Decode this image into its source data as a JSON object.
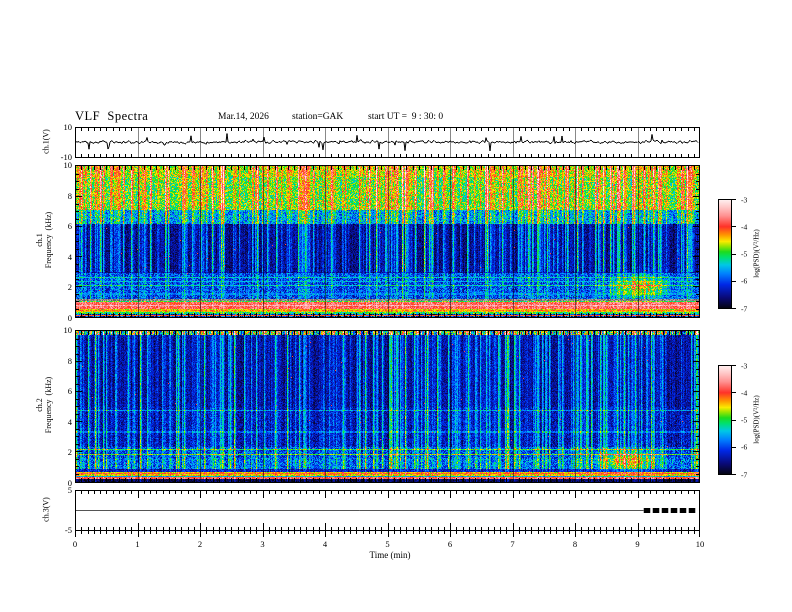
{
  "header": {
    "title": "VLF  Spectra",
    "date": "Mar.14, 2026",
    "station": "station=GAK",
    "start_ut": "start UT =  9 : 30: 0"
  },
  "axes": {
    "time": {
      "label": "Time  (min)",
      "ticks": [
        "0",
        "1",
        "2",
        "3",
        "4",
        "5",
        "6",
        "7",
        "8",
        "9",
        "10"
      ],
      "range": [
        0,
        10
      ]
    },
    "wave1": {
      "label": "ch.1(V)",
      "ticks": [
        "10",
        "-10"
      ],
      "range": [
        -10,
        10
      ]
    },
    "spec1": {
      "label_line1": "ch.1",
      "label_line2": "Frequency  (kHz)",
      "ticks": [
        "10",
        "8",
        "6",
        "4",
        "2",
        "0"
      ],
      "range": [
        0,
        10
      ]
    },
    "spec2": {
      "label_line1": "ch.2",
      "label_line2": "Frequency  (kHz)",
      "ticks": [
        "10",
        "8",
        "6",
        "4",
        "2",
        "0"
      ],
      "range": [
        0,
        10
      ]
    },
    "wave3": {
      "label": "ch.3(V)",
      "ticks": [
        "5",
        "-5"
      ],
      "range": [
        -5,
        5
      ]
    },
    "colorbar": {
      "label": "log(PSD)(V²/Hz)",
      "ticks": [
        "-3",
        "-4",
        "-5",
        "-6",
        "-7"
      ],
      "range": [
        -7,
        -3
      ]
    }
  },
  "colors": {
    "frame": "#000000",
    "waveform": "#000000",
    "ch3_line": "#555555",
    "minute_line_wave": "#888888",
    "colormap_stops": [
      [
        0.0,
        5,
        5,
        15
      ],
      [
        0.1,
        10,
        10,
        120
      ],
      [
        0.22,
        0,
        40,
        230
      ],
      [
        0.32,
        0,
        130,
        255
      ],
      [
        0.4,
        0,
        200,
        230
      ],
      [
        0.47,
        0,
        225,
        110
      ],
      [
        0.52,
        30,
        220,
        30
      ],
      [
        0.575,
        160,
        230,
        0
      ],
      [
        0.615,
        250,
        235,
        0
      ],
      [
        0.675,
        255,
        150,
        0
      ],
      [
        0.75,
        255,
        50,
        40
      ],
      [
        0.85,
        255,
        145,
        145
      ],
      [
        0.93,
        255,
        200,
        200
      ],
      [
        1.0,
        255,
        242,
        242
      ]
    ]
  },
  "chart_data": [
    {
      "type": "line",
      "name": "ch1_waveform",
      "title": "ch.1 (V) time series",
      "xlim": [
        0,
        10
      ],
      "ylim": [
        -10,
        10
      ],
      "summary": "Noisy trace centred on 0 V, typical excursions about ±2 V, frequent impulsive spikes reaching ±4 to ±8 V over the whole 10 min record",
      "render": {
        "seed": 11,
        "sigma": 1.0,
        "smooth": 0.45,
        "spike_prob": 0.05,
        "spike_min": 2,
        "spike_max": 6.5
      }
    },
    {
      "type": "heatmap",
      "name": "ch1_spectrogram",
      "title": "ch.1 VLF spectrogram",
      "xlabel": "Time (min)",
      "ylabel": "Frequency (kHz)",
      "xlim": [
        0,
        10
      ],
      "ylim": [
        0,
        10
      ],
      "zlim": [
        -7,
        -3
      ],
      "zlabel": "log(PSD)(V²/Hz)",
      "features": [
        "broadband green/cyan emission above ~7 kHz near -5",
        "dark navy background (~-6.5) from 3 to 6 kHz",
        "dense vertical impulsive streaks (sferics) spanning full height",
        "intense orange/red band 0.5-0.95 kHz near -3.8 with red core at ~0.75 kHz",
        "saturated gray row near 1 kHz",
        "narrow cyan lines near 2.1, 2.35 and 2.6 kHz",
        "green enhancement near 1.9 kHz between 8.7 and 9.4 min"
      ],
      "render": {
        "seed": 21,
        "bands": [
          [
            9.3,
            10,
            -4.75,
            0.45
          ],
          [
            7.1,
            9.3,
            -4.95,
            0.5
          ],
          [
            6.2,
            7.1,
            -5.7,
            0.55
          ],
          [
            2.9,
            6.2,
            -6.55,
            0.3
          ],
          [
            1.15,
            2.9,
            -6.05,
            0.5
          ],
          [
            1.02,
            1.15,
            -6,
            0
          ],
          [
            0.95,
            1.02,
            -5.0,
            0.4
          ],
          [
            0.52,
            0.95,
            -3.85,
            0.3
          ],
          [
            0.33,
            0.52,
            -4.55,
            0.35
          ],
          [
            0.18,
            0.33,
            -5.1,
            0.45
          ],
          [
            0.0,
            0.18,
            -6.3,
            0.9
          ]
        ],
        "gray_band": [
          1.02,
          1.15
        ],
        "hlines": [
          [
            2.08,
            -5.35
          ],
          [
            2.32,
            -5.6
          ],
          [
            2.6,
            -5.45
          ],
          [
            1.5,
            -5.8
          ],
          [
            0.74,
            -3.5
          ],
          [
            0.42,
            -4.3
          ],
          [
            0.05,
            -4.1
          ]
        ],
        "streaks": {
          "density": 0.5,
          "strength": 1.7,
          "atten": [
            [
              1,
              0.15
            ],
            [
              3,
              0.45
            ]
          ]
        },
        "blob": {
          "t": 9.05,
          "f": 1.95,
          "dt": 0.3,
          "df": 0.5,
          "boost": 1.4
        },
        "red_dot_prob": 0.0008
      }
    },
    {
      "type": "heatmap",
      "name": "ch2_spectrogram",
      "title": "ch.2 VLF spectrogram",
      "xlabel": "Time (min)",
      "ylabel": "Frequency (kHz)",
      "xlim": [
        0,
        10
      ],
      "ylim": [
        0,
        10
      ],
      "zlim": [
        -7,
        -3
      ],
      "zlabel": "log(PSD)(V²/Hz)",
      "features": [
        "mostly dark navy background (~-6.5) with dense thin vertical sferic streaks",
        "colorful columnar band in the top rows near 10 kHz",
        "narrow cyan/green lines near 1.78 and 2.12 kHz, fainter ones near 3.3 and 4.7 kHz",
        "bright green/yellow band 0.4-0.65 kHz near -4.5",
        "thin red band near 0.2 kHz, nearly black lowest rows",
        "green enhancement near 1.4 kHz between 8.5 and 9.2 min"
      ],
      "render": {
        "seed": 37,
        "bands": [
          [
            9.8,
            10,
            -5.2,
            0.8
          ],
          [
            5.0,
            9.8,
            -6.5,
            0.3
          ],
          [
            2.3,
            5.0,
            -6.4,
            0.35
          ],
          [
            1.55,
            2.3,
            -6.1,
            0.5
          ],
          [
            0.85,
            1.55,
            -5.95,
            0.5
          ],
          [
            0.62,
            0.85,
            -6.35,
            0.35
          ],
          [
            0.4,
            0.62,
            -4.55,
            0.35
          ],
          [
            0.28,
            0.4,
            -5.6,
            0.4
          ],
          [
            0.16,
            0.28,
            -3.95,
            0.25
          ],
          [
            0.0,
            0.16,
            -6.85,
            0.25
          ]
        ],
        "top_columnar": {
          "fmin": 9.8,
          "amp": 6
        },
        "hlines": [
          [
            1.78,
            -5.0
          ],
          [
            2.12,
            -5.15
          ],
          [
            3.3,
            -5.95
          ],
          [
            4.72,
            -5.75
          ],
          [
            0.52,
            -4.15
          ],
          [
            0.22,
            -3.9
          ]
        ],
        "streaks": {
          "density": 0.62,
          "strength": 1.45,
          "atten": [
            [
              0.8,
              0.3
            ]
          ]
        },
        "blob": {
          "t": 8.85,
          "f": 1.4,
          "dt": 0.3,
          "df": 0.45,
          "boost": 1.2
        },
        "red_dot_prob": 0.001
      }
    },
    {
      "type": "line",
      "name": "ch3_waveform",
      "title": "ch.3 (V) time series",
      "xlim": [
        0,
        10
      ],
      "ylim": [
        -5,
        5
      ],
      "summary": "Flat line at 0 V for the whole record; thick black dashed marker segment from ~9.1 to ~9.85 min",
      "render": {
        "flat_value": 0,
        "segment_start": 9.1,
        "segment_end": 9.85
      }
    }
  ]
}
